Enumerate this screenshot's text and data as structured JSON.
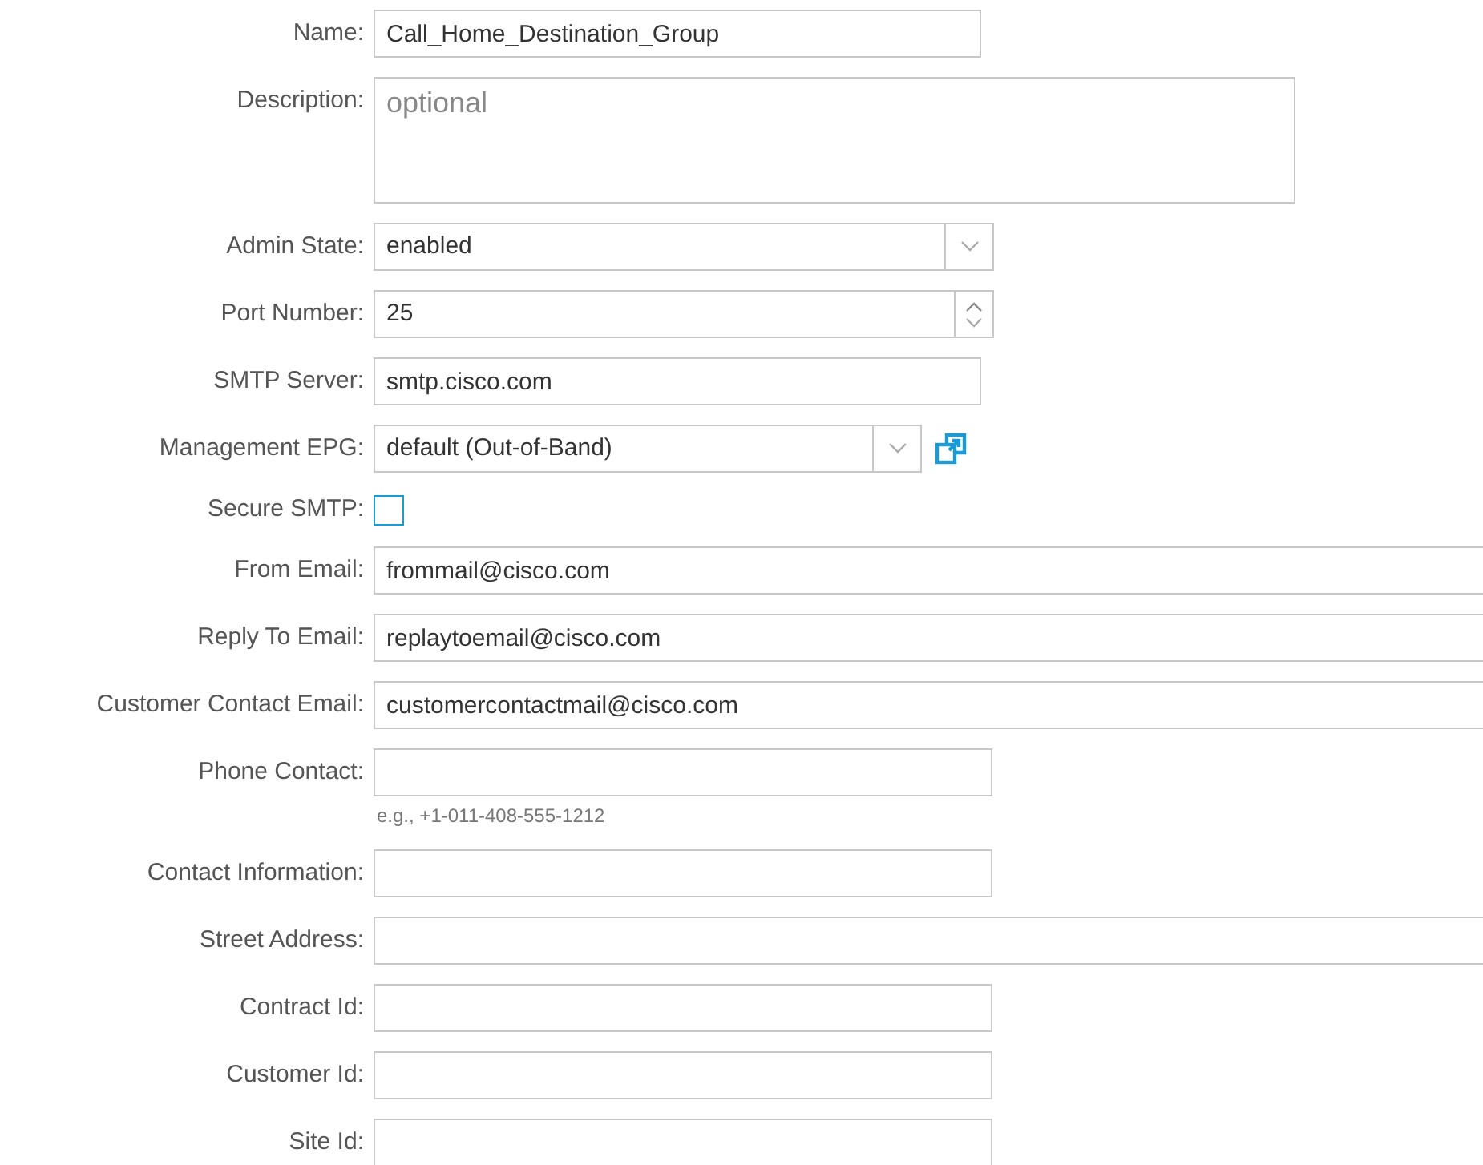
{
  "form": {
    "fields": [
      {
        "kind": "text",
        "label": "Name:",
        "value": "Call_Home_Destination_Group"
      },
      {
        "kind": "textarea",
        "label": "Description:",
        "placeholder": "optional"
      },
      {
        "kind": "select",
        "label": "Admin State:",
        "value": "enabled"
      },
      {
        "kind": "number",
        "label": "Port Number:",
        "value": "25"
      },
      {
        "kind": "text",
        "label": "SMTP Server:",
        "value": "smtp.cisco.com"
      },
      {
        "kind": "select-link",
        "label": "Management EPG:",
        "value": "default (Out-of-Band)"
      },
      {
        "kind": "checkbox",
        "label": "Secure SMTP:",
        "checked": false
      },
      {
        "kind": "text",
        "label": "From Email:",
        "value": "frommail@cisco.com"
      },
      {
        "kind": "text",
        "label": "Reply To Email:",
        "value": "replaytoemail@cisco.com"
      },
      {
        "kind": "text",
        "label": "Customer Contact Email:",
        "value": "customercontactmail@cisco.com"
      },
      {
        "kind": "text",
        "label": "Phone Contact:",
        "hint": "e.g., +1-011-408-555-1212"
      },
      {
        "kind": "text",
        "label": "Contact Information:"
      },
      {
        "kind": "text",
        "label": "Street Address:"
      },
      {
        "kind": "text",
        "label": "Contract Id:"
      },
      {
        "kind": "text",
        "label": "Customer Id:"
      },
      {
        "kind": "text",
        "label": "Site Id:"
      }
    ]
  }
}
